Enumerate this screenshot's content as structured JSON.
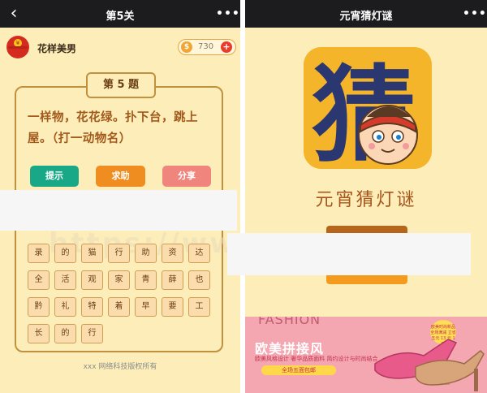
{
  "left": {
    "nav": {
      "title": "第5关",
      "more": "•••"
    },
    "user": {
      "name": "花样美男",
      "coins": "730",
      "plus": "+"
    },
    "question": {
      "tab": "第 5 题",
      "text": "一样物，花花绿。扑下台，跳上屋。（打一动物名）"
    },
    "buttons": {
      "hint": "提示",
      "help": "求助",
      "share": "分享"
    },
    "watermark": "https://www",
    "chars": [
      "录",
      "的",
      "猫",
      "行",
      "助",
      "资",
      "达",
      "全",
      "活",
      "观",
      "家",
      "青",
      "薛",
      "也",
      "黔",
      "礼",
      "特",
      "着",
      "早",
      "要",
      "工",
      "长",
      "的",
      "行"
    ],
    "copyright": "xxx 网络科技版权所有"
  },
  "right": {
    "nav": {
      "title": "元宵猜灯谜",
      "more": "•••"
    },
    "logo": {
      "char": "猜"
    },
    "app_title": "元宵猜灯谜",
    "ad": {
      "fashion": "FASHION",
      "title": "欧美拼接风",
      "subtitle": "欧美风格设计  奢华品质面料  简约设计与时尚结合",
      "pill": "全场五面包邮",
      "badge": "欧美时尚新品 全场满减 立省五元 13 元  1  用"
    }
  },
  "colors": {
    "bg": "#fdeeb9",
    "navbar": "#1c1c1e",
    "hint": "#19a887",
    "help": "#f08d20",
    "share": "#f0857e",
    "card_border": "#c2913f",
    "question_text": "#a2591c"
  }
}
